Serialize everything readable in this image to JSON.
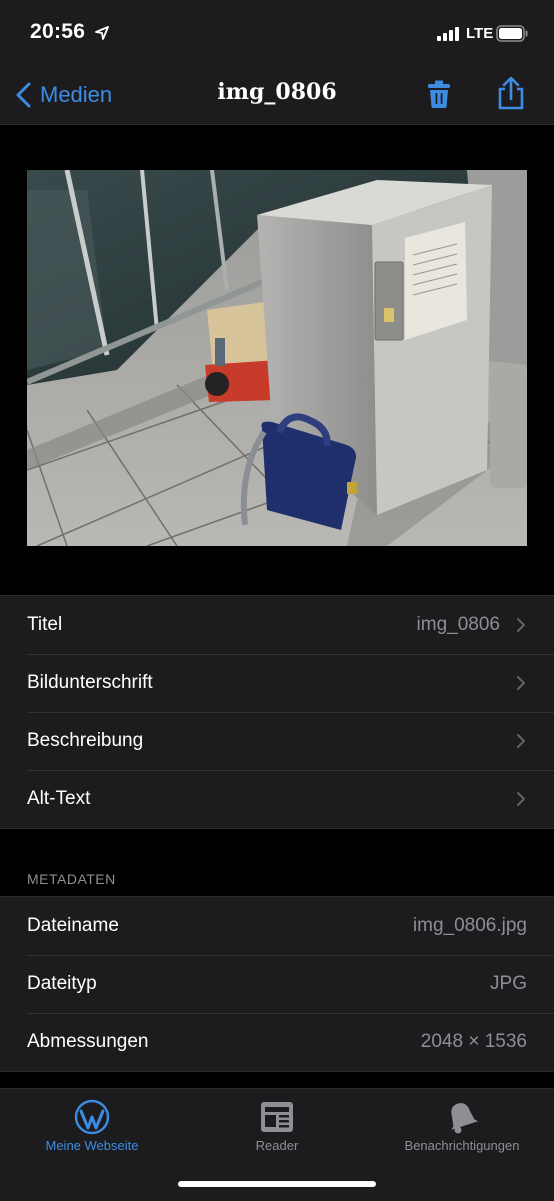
{
  "status": {
    "time": "20:56",
    "network": "LTE"
  },
  "nav": {
    "back_label": "Medien",
    "title": "img_0806"
  },
  "fields": [
    {
      "label": "Titel",
      "value": "img_0806"
    },
    {
      "label": "Bildunterschrift",
      "value": ""
    },
    {
      "label": "Beschreibung",
      "value": ""
    },
    {
      "label": "Alt-Text",
      "value": ""
    }
  ],
  "metadata": {
    "header": "METADATEN",
    "rows": [
      {
        "label": "Dateiname",
        "value": "img_0806.jpg"
      },
      {
        "label": "Dateityp",
        "value": "JPG"
      },
      {
        "label": "Abmessungen",
        "value": "2048 × 1536"
      }
    ]
  },
  "tabs": [
    {
      "label": "Meine Webseite",
      "active": true,
      "icon": "wordpress-icon"
    },
    {
      "label": "Reader",
      "active": false,
      "icon": "reader-icon"
    },
    {
      "label": "Benachrichtigungen",
      "active": false,
      "icon": "bell-icon"
    }
  ],
  "colors": {
    "accent": "#3d8ce4",
    "background": "#000000",
    "cell": "#1c1c1e",
    "secondary_text": "#8e8e93",
    "inactive_tab": "#8e8e93"
  }
}
